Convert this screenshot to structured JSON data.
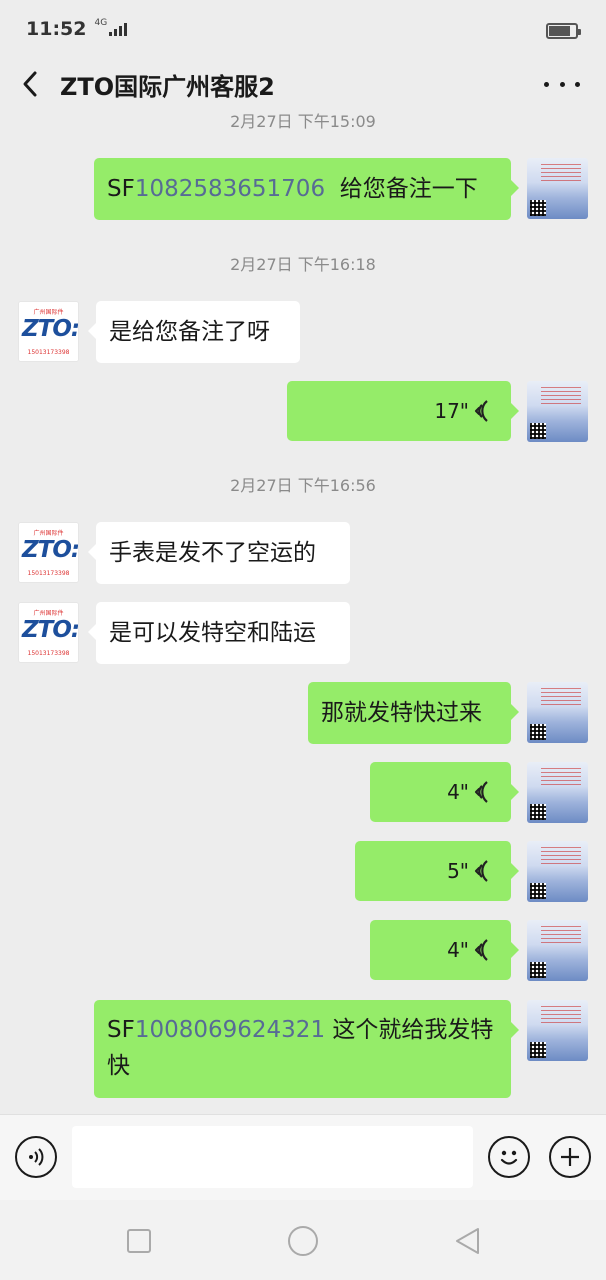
{
  "status_bar": {
    "time": "11:52",
    "network": "4G",
    "battery_level": 0.75
  },
  "header": {
    "title": "ZTO国际广州客服2"
  },
  "avatar_logo": {
    "top_text": "广州国际件",
    "mark": "ZTO:",
    "phone": "15013173398"
  },
  "chat": {
    "partial_timestamp": "2月27日 下午15:09",
    "msg1": {
      "prefix": "SF",
      "link": "1082583651706",
      "suffix": "  给您备注一下"
    },
    "ts1": "2月27日 下午16:18",
    "msg2": "是给您备注了呀",
    "msg3_voice": "17\"",
    "ts2": "2月27日 下午16:56",
    "msg4": "手表是发不了空运的",
    "msg5": "是可以发特空和陆运",
    "msg6": "那就发特快过来",
    "msg7_voice": "4\"",
    "msg8_voice": "5\"",
    "msg9_voice": "4\"",
    "msg10": {
      "prefix": "SF",
      "link": "1008069624321",
      "suffix": " 这个就给我发特",
      "line2": "快"
    }
  },
  "input_bar": {
    "value": "",
    "placeholder": ""
  },
  "icons": {
    "voice_toggle": "voice-mode-icon",
    "emoji": "emoji-icon",
    "plus": "plus-icon",
    "back": "back-arrow-icon",
    "more": "more-icon"
  },
  "colors": {
    "sent_bubble": "#95ec69",
    "received_bubble": "#ffffff",
    "link": "#576b95",
    "background": "#ededed"
  }
}
